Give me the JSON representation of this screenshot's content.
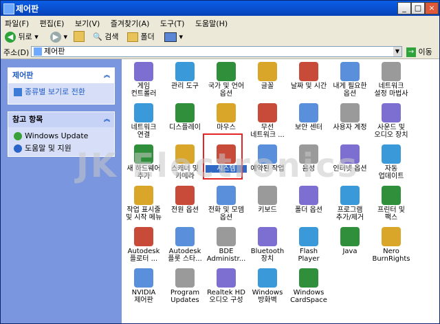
{
  "window": {
    "title": "제어판"
  },
  "menu": [
    "파일(F)",
    "편집(E)",
    "보기(V)",
    "즐겨찾기(A)",
    "도구(T)",
    "도움말(H)"
  ],
  "toolbar": {
    "back": "뒤로",
    "search": "검색",
    "folders": "폴더"
  },
  "address": {
    "label": "주소(D)",
    "value": "제어판",
    "go": "이동"
  },
  "sidebar": {
    "panel1": {
      "title": "제어판",
      "link": "종류별 보기로 전환"
    },
    "panel2": {
      "title": "참고 항목",
      "items": [
        "Windows Update",
        "도움말 및 지원"
      ]
    }
  },
  "items": [
    [
      "게임\n컨트롤러",
      "관리 도구",
      "국가 및 언어\n옵션",
      "글꼴",
      "날짜 및 시간",
      "내게 필요한\n옵션",
      "네트워크\n설정 마법사"
    ],
    [
      "네트워크\n연결",
      "디스플레이",
      "마우스",
      "무선\n네트워크 ...",
      "보안 센터",
      "사용자 계정",
      "사운드 및\n오디오 장치"
    ],
    [
      "새 하드웨어\n추가",
      "스캐너 및\n카메라",
      "시스템",
      "예약된 작업",
      "음성",
      "인터넷 옵션",
      "자동\n업데이트"
    ],
    [
      "작업 표시줄\n및 시작 메뉴",
      "전원 옵션",
      "전화 및 모뎀\n옵션",
      "키보드",
      "폴더 옵션",
      "프로그램\n추가/제거",
      "프린터 및\n팩스"
    ],
    [
      "Autodesk\n플로터 ...",
      "Autodesk\n플롯 스타...",
      "BDE\nAdministr...",
      "Bluetooth\n장치",
      "Flash Player",
      "Java",
      "Nero\nBurnRights"
    ],
    [
      "NVIDIA\n제어판",
      "Program\nUpdates",
      "Realtek HD\n오디오 구성",
      "Windows\n방화벽",
      "Windows\nCardSpace"
    ]
  ],
  "icon_colors": [
    "#7c6fd1",
    "#3a9ad9",
    "#2f8f3a",
    "#d9a62a",
    "#c84b3a",
    "#5a8fdc",
    "#9a9a9a"
  ],
  "watermark": "JK Electronics",
  "accent": "#0842b8",
  "sidebar_bg": "#7a96df",
  "highlight": "#e32424"
}
